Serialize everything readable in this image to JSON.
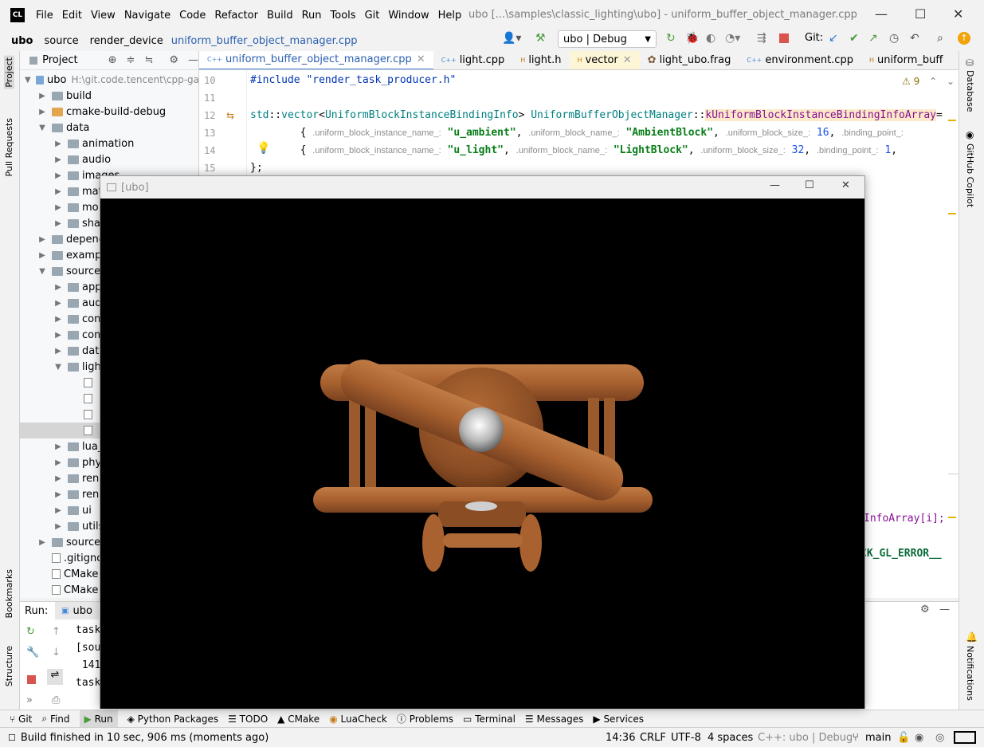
{
  "app": {
    "logo": "CL"
  },
  "menu": [
    "File",
    "Edit",
    "View",
    "Navigate",
    "Code",
    "Refactor",
    "Build",
    "Run",
    "Tools",
    "Git",
    "Window",
    "Help"
  ],
  "window_title": "ubo [...\\samples\\classic_lighting\\ubo] - uniform_buffer_object_manager.cpp",
  "breadcrumb": [
    "ubo",
    "source",
    "render_device",
    "uniform_buffer_object_manager.cpp"
  ],
  "toolbar": {
    "run_config": "ubo | Debug",
    "git_label": "Git:"
  },
  "left_strip": {
    "project": "Project",
    "pull_requests": "Pull Requests",
    "bookmarks": "Bookmarks",
    "structure": "Structure"
  },
  "right_strip": {
    "database": "Database",
    "copilot": "GitHub Copilot",
    "notifications": "Notifications"
  },
  "project_panel": {
    "title": "Project",
    "root": {
      "name": "ubo",
      "path": "H:\\git.code.tencent\\cpp-ga"
    },
    "items": [
      {
        "name": "build",
        "type": "folder"
      },
      {
        "name": "cmake-build-debug",
        "type": "folder-orange"
      },
      {
        "name": "data",
        "type": "folder-open"
      },
      {
        "name": "animation",
        "type": "sub"
      },
      {
        "name": "audio",
        "type": "sub"
      },
      {
        "name": "images",
        "type": "sub"
      },
      {
        "name": "mat",
        "type": "sub"
      },
      {
        "name": "mo",
        "type": "sub"
      },
      {
        "name": "sha",
        "type": "sub"
      },
      {
        "name": "depend",
        "type": "folder"
      },
      {
        "name": "examp",
        "type": "folder"
      },
      {
        "name": "source",
        "type": "folder-open"
      },
      {
        "name": "app",
        "type": "sub"
      },
      {
        "name": "aud",
        "type": "sub"
      },
      {
        "name": "con",
        "type": "sub"
      },
      {
        "name": "com",
        "type": "sub"
      },
      {
        "name": "dat",
        "type": "sub"
      },
      {
        "name": "ligh",
        "type": "sub-open"
      },
      {
        "name": "",
        "type": "file"
      },
      {
        "name": "",
        "type": "file"
      },
      {
        "name": "",
        "type": "file"
      },
      {
        "name": "",
        "type": "file"
      },
      {
        "name": "lua_",
        "type": "sub"
      },
      {
        "name": "phy",
        "type": "sub"
      },
      {
        "name": "ren",
        "type": "sub"
      },
      {
        "name": "ren",
        "type": "sub"
      },
      {
        "name": "ui",
        "type": "sub"
      },
      {
        "name": "utils",
        "type": "sub"
      },
      {
        "name": "source",
        "type": "folder"
      },
      {
        "name": ".gitigno",
        "type": "plain"
      },
      {
        "name": "CMake",
        "type": "plain"
      },
      {
        "name": "CMake",
        "type": "plain"
      }
    ]
  },
  "editor": {
    "tabs": [
      "uniform_buffer_object_manager.cpp",
      "light.cpp",
      "light.h",
      "vector",
      "light_ubo.frag",
      "environment.cpp",
      "uniform_buff"
    ],
    "warnings": "9",
    "lines": [
      "10",
      "11",
      "12",
      "13",
      "14",
      "15"
    ],
    "code": {
      "include": "#include \"render_task_producer.h\"",
      "l12_std": "std",
      "l12_vector": "vector",
      "l12_type": "UniformBlockInstanceBindingInfo",
      "l12_class": "UniformBufferObjectManager",
      "l12_member": "kUniformBlockInstanceBindingInfoArray",
      "l13_name_hint": ".uniform_block_instance_name_:",
      "l13_name": "\"u_ambient\"",
      "l13_block_hint": ".uniform_block_name_:",
      "l13_block": "\"AmbientBlock\"",
      "l13_size_hint": ".uniform_block_size_:",
      "l13_size": "16",
      "l13_bind_hint": ".binding_point_:",
      "l14_name": "\"u_light\"",
      "l14_block": "\"LightBlock\"",
      "l14_size": "32",
      "l14_bind": "1",
      "l15": "};",
      "right_frag1": "InfoArray[i];",
      "right_frag2": "CK_GL_ERROR__"
    }
  },
  "run_panel": {
    "label": "Run:",
    "tab": "ubo",
    "lines": [
      "task",
      "[sou",
      " 141",
      "task"
    ]
  },
  "gl_window": {
    "title": "[ubo]"
  },
  "bottom_tabs": [
    "Git",
    "Find",
    "Run",
    "Python Packages",
    "TODO",
    "CMake",
    "LuaCheck",
    "Problems",
    "Terminal",
    "Messages",
    "Services"
  ],
  "status": {
    "message": "Build finished in 10 sec, 906 ms (moments ago)",
    "position": "14:36",
    "line_ending": "CRLF",
    "encoding": "UTF-8",
    "indent": "4 spaces",
    "context": "C++: ubo | Debug",
    "branch": "main"
  }
}
